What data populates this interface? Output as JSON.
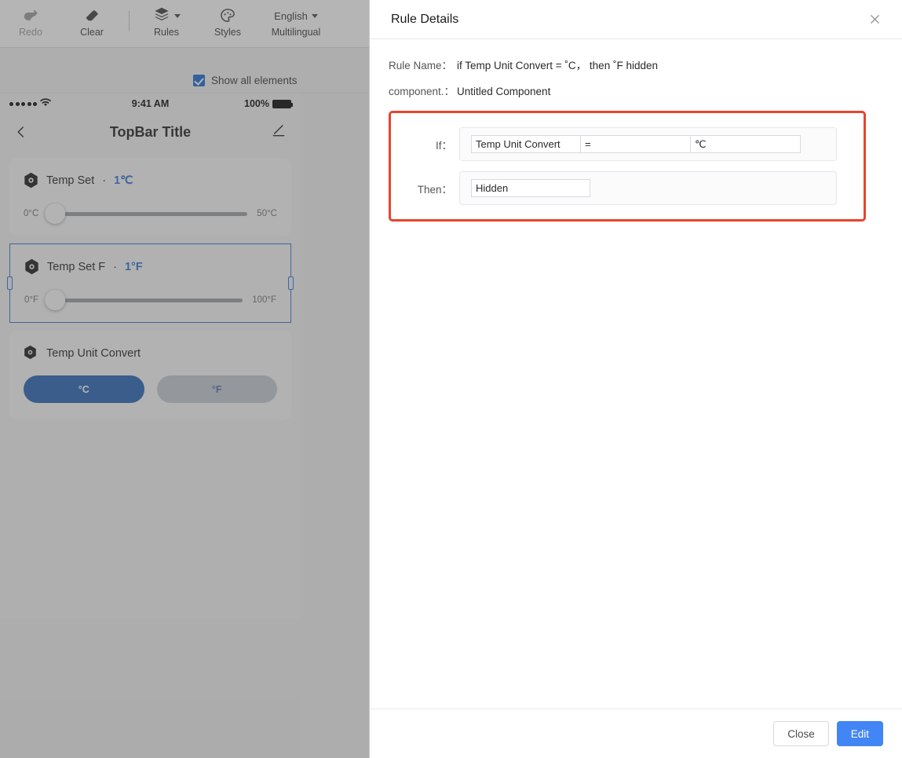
{
  "toolbar": {
    "items": [
      {
        "label": "Redo",
        "icon": "redo-icon",
        "disabled": true,
        "caret": false
      },
      {
        "label": "Clear",
        "icon": "eraser-icon",
        "disabled": false,
        "caret": false
      },
      {
        "label": "Rules",
        "icon": "layers-icon",
        "disabled": false,
        "caret": true
      },
      {
        "label": "Styles",
        "icon": "palette-icon",
        "disabled": false,
        "caret": false
      },
      {
        "label": "Multilingual",
        "icon": "language-text",
        "disabled": false,
        "caret": true,
        "value": "English"
      }
    ]
  },
  "subbar": {
    "show_all_label": "Show all elements",
    "show_all_checked": true
  },
  "phone": {
    "status": {
      "time": "9:41 AM",
      "battery_percent": "100%",
      "signal_dots": 5
    },
    "topbar": {
      "title": "TopBar Title",
      "back_icon": "chevron-left-icon",
      "edit_icon": "pencil-icon"
    },
    "cards": [
      {
        "type": "slider",
        "name": "Temp Set",
        "separator": "·",
        "value": "1℃",
        "min_label": "0°C",
        "max_label": "50°C",
        "selected": false
      },
      {
        "type": "slider",
        "name": "Temp Set F",
        "separator": "·",
        "value": "1°F",
        "min_label": "0°F",
        "max_label": "100°F",
        "selected": true
      },
      {
        "type": "segment",
        "name": "Temp Unit Convert",
        "options": [
          {
            "label": "°C",
            "active": true
          },
          {
            "label": "°F",
            "active": false
          }
        ]
      }
    ]
  },
  "panel": {
    "title": "Rule Details",
    "close_icon": "close-icon",
    "fields": [
      {
        "label": "Rule Name：",
        "value": "if Temp Unit Convert = ˚C， then ˚F hidden"
      },
      {
        "label": "component.：",
        "value": "Untitled Component"
      }
    ],
    "rule": {
      "if_label": "If：",
      "if_subject": "Temp Unit Convert",
      "if_operator": "=",
      "if_value": "℃",
      "then_label": "Then：",
      "then_action": "Hidden",
      "highlight_color": "#e8452c"
    },
    "footer": {
      "close_label": "Close",
      "edit_label": "Edit",
      "primary_color": "#4285f4"
    }
  },
  "colors": {
    "accent_blue": "#2b6fd6",
    "segment_on": "#1f5fb5",
    "checkbox": "#1464d2",
    "rule_border": "#e8452c"
  }
}
